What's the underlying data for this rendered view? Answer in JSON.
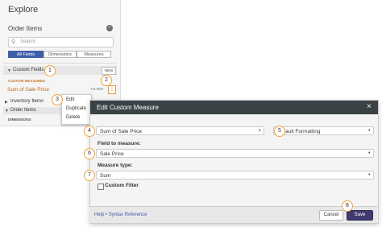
{
  "explore": {
    "title": "Explore",
    "view_title": "Order Items",
    "collapse_icon": "minus-circle-icon",
    "search_placeholder": "Search",
    "tabs": [
      "All Fields",
      "Dimensions",
      "Measures"
    ],
    "active_tab": "All Fields",
    "custom_fields_label": "Custom Fields",
    "new_label": "NEW",
    "custom_measures_header": "CUSTOM MEASURES",
    "custom_measure_item": "Sum of Sale Price",
    "filter_label": "FILTER",
    "more_icon": "ellipsis-icon",
    "inventory_items_label": "Inventory Items",
    "order_items_label": "Order Items",
    "dimensions_header": "DIMENSIONS"
  },
  "context_menu": {
    "items": [
      "Edit",
      "Duplicate",
      "Delete"
    ]
  },
  "callouts": [
    "1",
    "2",
    "3",
    "4",
    "5",
    "6",
    "7",
    "8"
  ],
  "modal": {
    "title": "Edit Custom Measure",
    "close_icon": "close-icon",
    "name_value": "Sum of Sale Price",
    "format_value": "Default Formatting",
    "field_to_measure_label": "Field to measure:",
    "field_value": "Sale Price",
    "measure_type_label": "Measure type:",
    "measure_type_value": "Sum",
    "custom_filter_label": "Custom Filter",
    "help_link": "Help • Syntax Reference",
    "cancel_label": "Cancel",
    "save_label": "Save"
  },
  "colors": {
    "accent": "#3f5ea8",
    "callout_ring": "#f0a23a",
    "header_dark": "#3a4245",
    "save_button": "#3f3a6e",
    "custom_orange": "#c9782a"
  }
}
